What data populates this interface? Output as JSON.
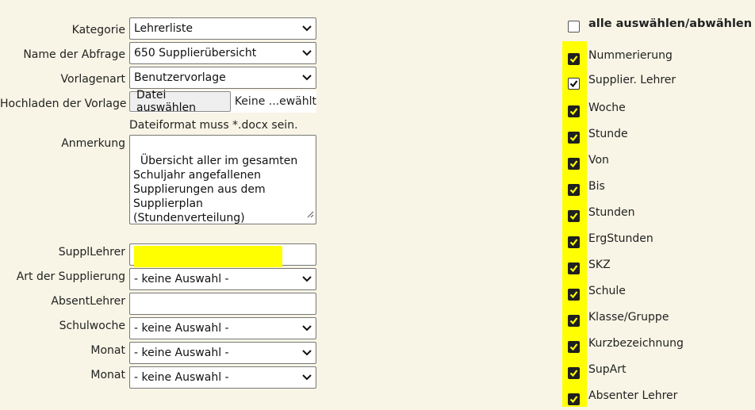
{
  "form": {
    "kategorie": {
      "label": "Kategorie",
      "value": "Lehrerliste"
    },
    "abfrage": {
      "label": "Name der Abfrage",
      "value": "650 Supplierübersicht"
    },
    "vorlagenart": {
      "label": "Vorlagenart",
      "value": "Benutzervorlage"
    },
    "upload": {
      "label": "Hochladen der Vorlage",
      "button": "Datei auswählen",
      "status": "Keine ...ewählt"
    },
    "format_note": "Dateiformat muss *.docx sein.",
    "anmerkung": {
      "label": "Anmerkung",
      "value": "Übersicht aller im gesamten\nSchuljahr angefallenen\nSupplierungen aus dem\nSupplierplan (Stundenverteilung)"
    },
    "suppl_lehrer": {
      "label": "SupplLehrer",
      "value": ""
    },
    "art": {
      "label": "Art der Supplierung",
      "value": "- keine Auswahl -"
    },
    "absent_lehrer": {
      "label": "AbsentLehrer",
      "value": ""
    },
    "schulwoche": {
      "label": "Schulwoche",
      "value": "- keine Auswahl -"
    },
    "monat1": {
      "label": "Monat",
      "value": "- keine Auswahl -"
    },
    "monat2": {
      "label": "Monat",
      "value": "- keine Auswahl -"
    }
  },
  "columns": {
    "select_all_label": "alle auswählen/abwählen",
    "select_all_checked": false,
    "items": [
      {
        "label": "Nummerierung",
        "checked": true
      },
      {
        "label": "Supplier. Lehrer",
        "checked": true
      },
      {
        "label": "Woche",
        "checked": true
      },
      {
        "label": "Stunde",
        "checked": true
      },
      {
        "label": "Von",
        "checked": true
      },
      {
        "label": "Bis",
        "checked": true
      },
      {
        "label": "Stunden",
        "checked": true
      },
      {
        "label": "ErgStunden",
        "checked": true
      },
      {
        "label": "SKZ",
        "checked": true
      },
      {
        "label": "Schule",
        "checked": true
      },
      {
        "label": "Klasse/Gruppe",
        "checked": true
      },
      {
        "label": "Kurzbezeichnung",
        "checked": true
      },
      {
        "label": "SupArt",
        "checked": true
      },
      {
        "label": "Absenter Lehrer",
        "checked": true
      }
    ]
  },
  "colors": {
    "highlight": "#ffff00",
    "background": "#f8f5e6"
  }
}
